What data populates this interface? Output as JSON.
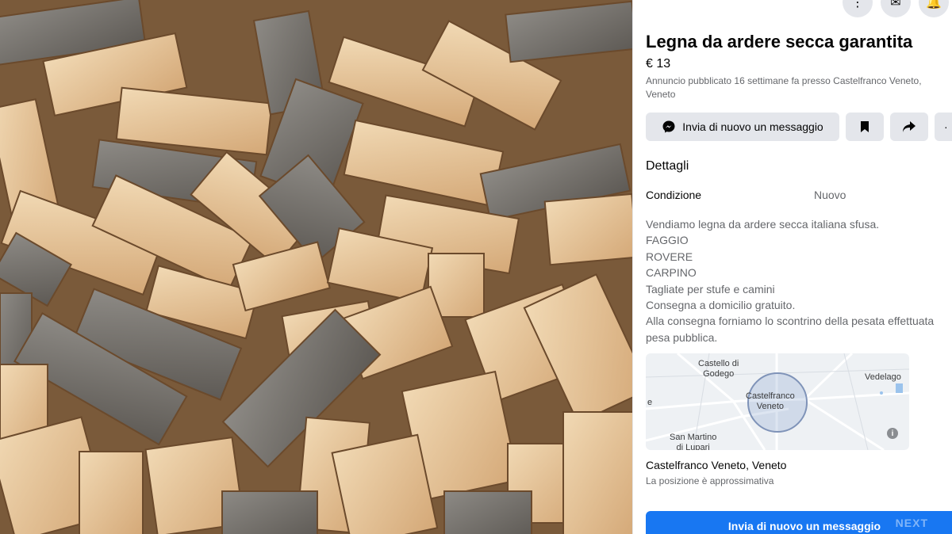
{
  "listing": {
    "title": "Legna da ardere secca garantita",
    "price": "€ 13",
    "meta_line1": "Annuncio pubblicato 16 settimane fa presso Castelfranco Veneto,",
    "meta_line2": "Veneto"
  },
  "actions": {
    "message_label": "Invia di nuovo un messaggio",
    "message_icon": "messenger-icon",
    "save_icon": "bookmark-icon",
    "share_icon": "share-icon",
    "more_label": "·"
  },
  "top_icons": [
    "grid-icon",
    "messenger-icon",
    "notification-icon"
  ],
  "details": {
    "heading": "Dettagli",
    "condition_label": "Condizione",
    "condition_value": "Nuovo"
  },
  "description": [
    "Vendiamo legna da ardere secca italiana sfusa.",
    "FAGGIO",
    "ROVERE",
    "CARPINO",
    "Tagliate per stufe e camini",
    "Consegna a domicilio gratuito.",
    "Alla consegna forniamo lo scontrino della pesata effettuata",
    "pesa pubblica."
  ],
  "map": {
    "label_castello": "Castello di\nGodego",
    "label_center": "Castelfranco\nVeneto",
    "label_vedelago": "Vedelago",
    "label_sanmartino": "San Martino\ndi Lupari",
    "label_e": "e",
    "info": "i"
  },
  "location": {
    "title": "Castelfranco Veneto, Veneto",
    "subtitle": "La posizione è approssimativa"
  },
  "primary_button": {
    "label": "Invia di nuovo un messaggio"
  },
  "watermark": "NEXT",
  "colors": {
    "accent": "#1877f2",
    "button_gray": "#e4e6eb",
    "secondary_text": "#65676b"
  }
}
